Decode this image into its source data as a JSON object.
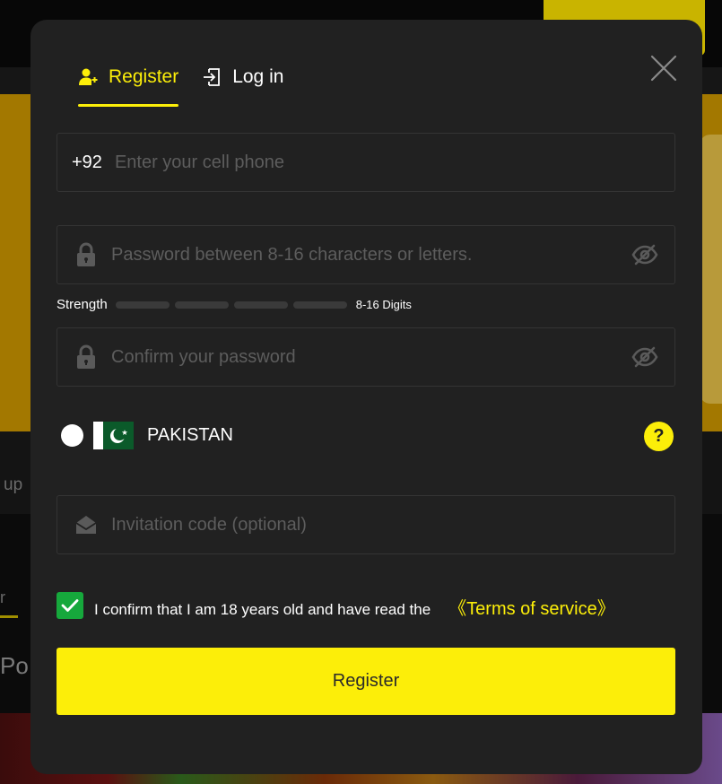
{
  "background": {
    "partial_text_1": "up",
    "partial_text_2": "r",
    "partial_text_3": "Po"
  },
  "tabs": {
    "register_label": "Register",
    "login_label": "Log in"
  },
  "phone": {
    "country_code": "+92",
    "placeholder": "Enter your cell phone",
    "value": ""
  },
  "password": {
    "placeholder": "Password between 8-16 characters or letters.",
    "value": ""
  },
  "strength": {
    "label": "Strength",
    "hint": "8-16 Digits",
    "filled_segments": 0
  },
  "confirm_password": {
    "placeholder": "Confirm your password",
    "value": ""
  },
  "country": {
    "name": "PAKISTAN",
    "help": "?"
  },
  "invitation": {
    "placeholder": "Invitation code (optional)",
    "value": ""
  },
  "agreement": {
    "checked": true,
    "text": "I confirm that I am 18 years old and have read the",
    "link_text": "《Terms of service》"
  },
  "submit_label": "Register",
  "colors": {
    "accent": "#fcee09",
    "modal_bg": "#212121",
    "checkbox_green": "#16a83c",
    "placeholder": "#5d5d5d"
  },
  "icons": {
    "register_tab": "user-add-icon",
    "login_tab": "login-icon",
    "close": "close-icon",
    "lock": "lock-icon",
    "eye_slash": "eye-slash-icon",
    "invite": "envelope-open-icon",
    "flag": "pakistan-flag-icon",
    "check": "check-icon"
  }
}
